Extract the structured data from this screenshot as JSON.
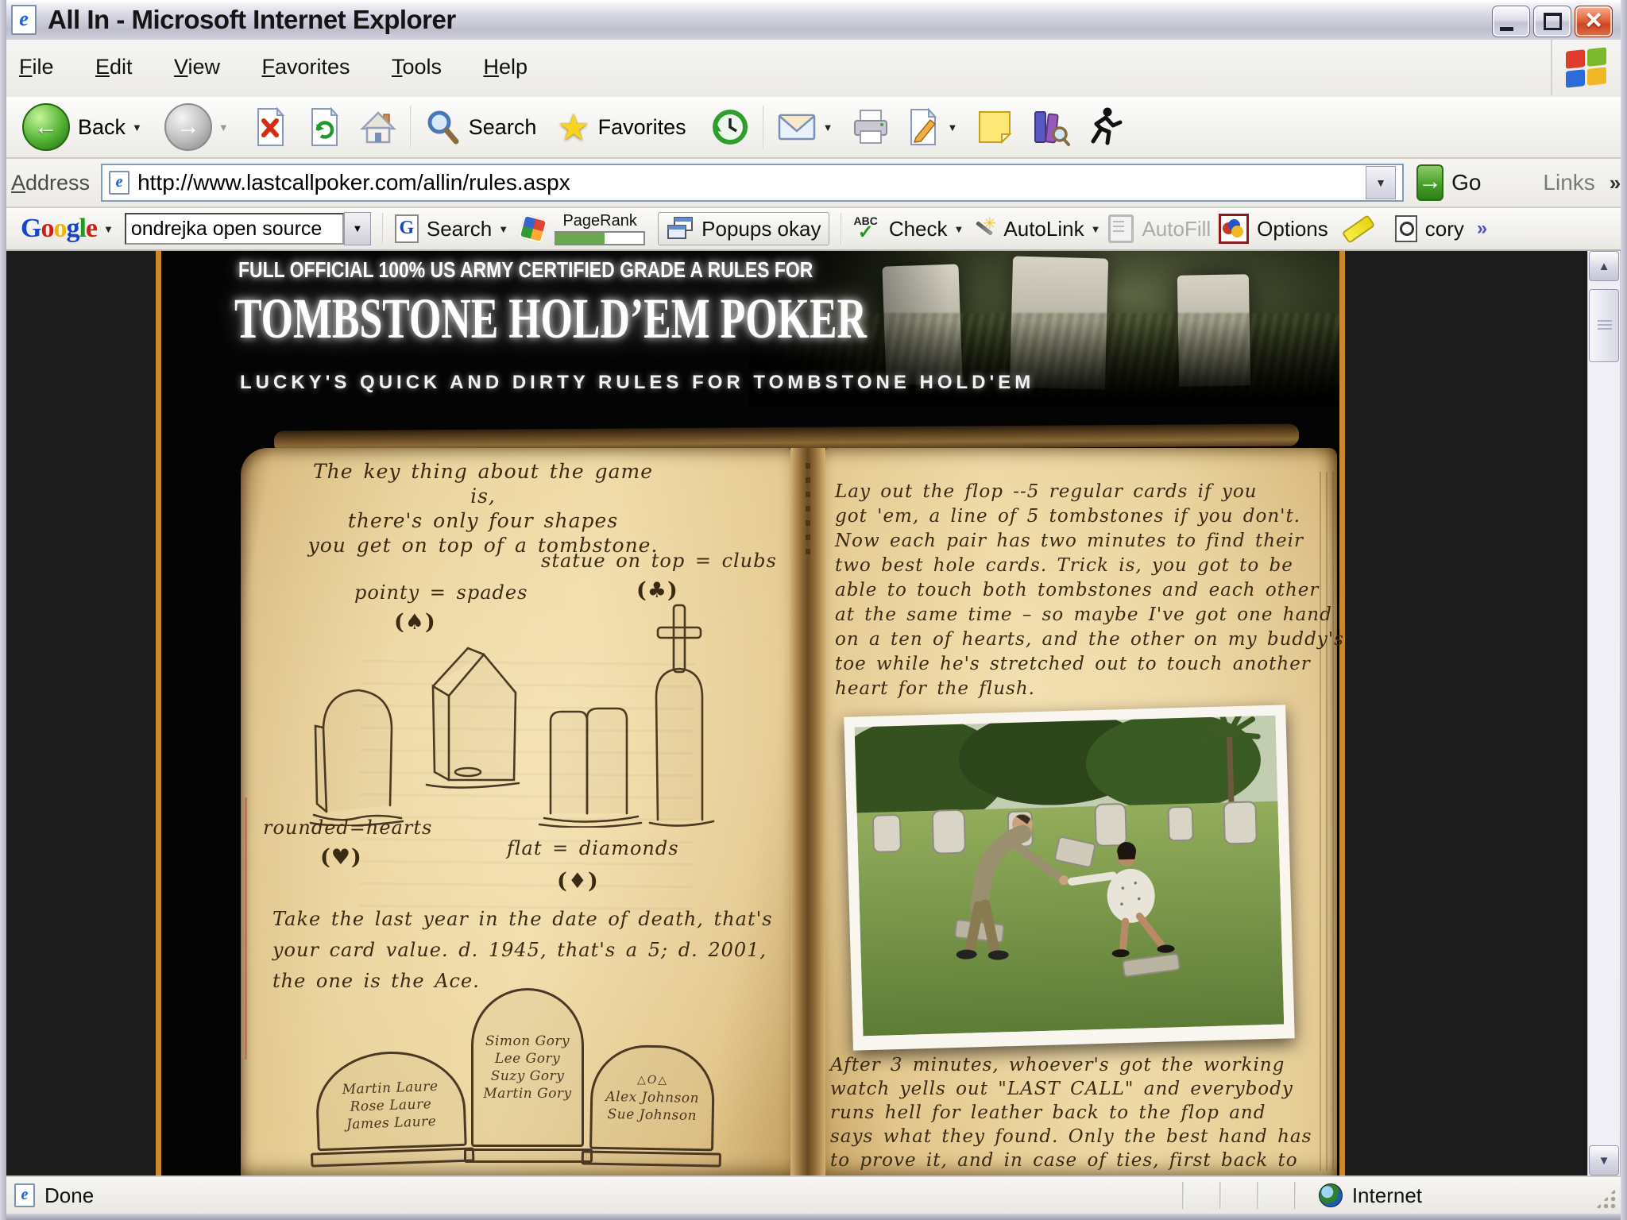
{
  "window": {
    "title": "All In - Microsoft Internet Explorer"
  },
  "menu": {
    "items": [
      "File",
      "Edit",
      "View",
      "Favorites",
      "Tools",
      "Help"
    ]
  },
  "toolbar": {
    "back": "Back",
    "search": "Search",
    "favorites": "Favorites"
  },
  "address": {
    "label": "Address",
    "url": "http://www.lastcallpoker.com/allin/rules.aspx",
    "go": "Go",
    "links": "Links"
  },
  "google": {
    "logo_letters": [
      "G",
      "o",
      "o",
      "g",
      "l",
      "e"
    ],
    "query": "ondrejka open source",
    "search": "Search",
    "pagerank": "PageRank",
    "popups": "Popups okay",
    "check_abc": "ABC",
    "check": "Check",
    "autolink": "AutoLink",
    "autofill": "AutoFill",
    "options": "Options",
    "account": "cory"
  },
  "status": {
    "done": "Done",
    "zone": "Internet"
  },
  "glyphs": {
    "dropdown": "▼",
    "back_arrow": "←",
    "forward_arrow": "→",
    "go_arrow": "→",
    "star": "★",
    "check": "✓",
    "chevron": "»",
    "close": "×",
    "scroll_up": "▲",
    "scroll_down": "▼",
    "e_logo": "e",
    "sparkle": "✳"
  },
  "content": {
    "kicker": "FULL OFFICIAL 100% US ARMY CERTIFIED GRADE A RULES FOR",
    "title": "TOMBSTONE HOLD’EM POKER",
    "subtitle": "LUCKY'S QUICK AND DIRTY RULES FOR TOMBSTONE HOLD'EM",
    "left_page": {
      "intro": [
        "The key thing about the game is,",
        "there's only four shapes",
        "you get on top of a tombstone."
      ],
      "clubs_label": "statue on top = clubs",
      "clubs_sym": "(♣)",
      "spades_label": "pointy = spades",
      "spades_sym": "(♠)",
      "hearts_label": "rounded=hearts",
      "hearts_sym": "(♥)",
      "diamonds_label": "flat = diamonds",
      "diamonds_sym": "(♦)",
      "value_rule": [
        "Take the last year in the date of death, that's",
        "your card value. d. 1945, that's a 5; d. 2001,",
        "the one is the Ace."
      ],
      "stones": {
        "laure": [
          "Martin Laure",
          "Rose Laure",
          "James Laure"
        ],
        "gory": [
          "Simon Gory",
          "Lee Gory",
          "Suzy Gory",
          "Martin Gory"
        ],
        "johnson_deco": "△O△",
        "johnson": [
          "Alex Johnson",
          "Sue Johnson"
        ]
      }
    },
    "right_page": {
      "para1": [
        "Lay out the flop --5 regular cards if you",
        "got 'em, a line of 5 tombstones if you don't.",
        "Now each pair has two minutes to find their",
        "two best hole cards. Trick is, you got to be",
        "able to touch both tombstones and each other",
        "at the same time – so maybe I've got one hand",
        "on a ten of hearts, and the other on my buddy's",
        "toe while he's stretched out to touch another",
        "heart for the flush."
      ],
      "para2": [
        "After 3 minutes, whoever's got the working",
        "watch yells out \"LAST CALL\" and everybody",
        "runs hell for leather back to the flop and",
        "says what they found.  Only the best hand has",
        "to prove it, and in case of ties, first back to"
      ]
    }
  },
  "colors": {
    "accent_orange": "#c9882e",
    "paper": "#e9d098",
    "ink": "#3a2a14",
    "close_red": "#cc4524"
  }
}
